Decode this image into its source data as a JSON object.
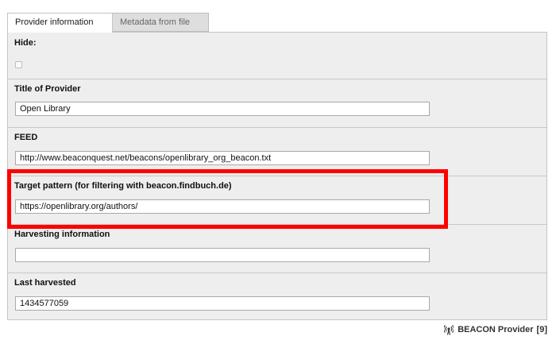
{
  "tabs": [
    {
      "label": "Provider information",
      "active": true
    },
    {
      "label": "Metadata from file",
      "active": false
    }
  ],
  "fields": {
    "hide": {
      "label": "Hide:",
      "checked": false
    },
    "title": {
      "label": "Title of Provider",
      "value": "Open Library"
    },
    "feed": {
      "label": "FEED",
      "value": "http://www.beaconquest.net/beacons/openlibrary_org_beacon.txt"
    },
    "target": {
      "label": "Target pattern (for filtering with beacon.findbuch.de)",
      "value": "https://openlibrary.org/authors/"
    },
    "harvesting": {
      "label": "Harvesting information",
      "value": ""
    },
    "last_harvested": {
      "label": "Last harvested",
      "value": "1434577059"
    }
  },
  "footer": {
    "record_type": "BEACON Provider",
    "record_uid": "[9]",
    "icon": "beacon-antenna-icon"
  },
  "colors": {
    "highlight": "#ff0000",
    "panel_bg": "#eeeeee",
    "tab_inactive_bg": "#dedede"
  }
}
